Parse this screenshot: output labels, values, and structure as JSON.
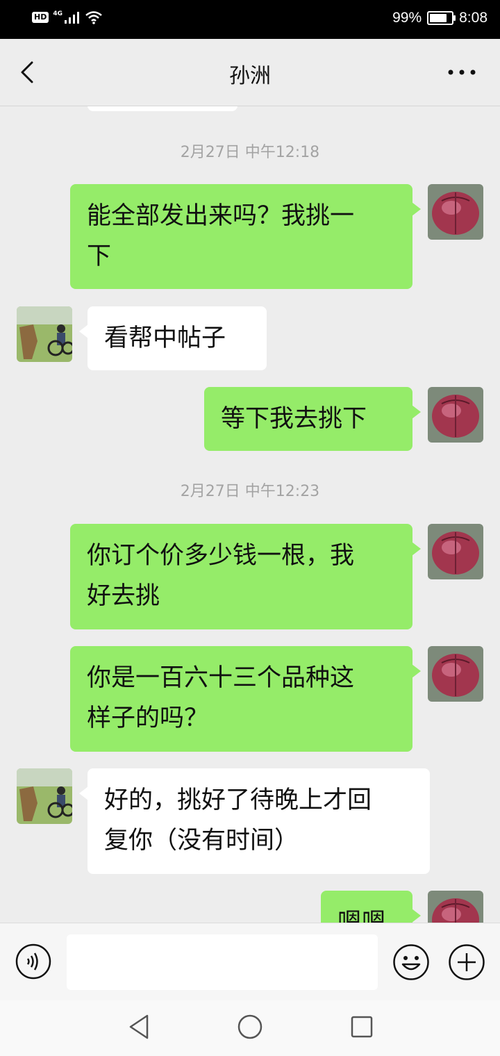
{
  "status_bar": {
    "hd": "HD",
    "network": "4G",
    "battery": "99%",
    "time": "8:08"
  },
  "header": {
    "title": "孙洲"
  },
  "chat": {
    "timestamps": [
      "2月27日 中午12:18",
      "2月27日 中午12:23"
    ],
    "messages": [
      {
        "side": "right",
        "line1": "能全部发出来吗？我挑一",
        "line2": "下"
      },
      {
        "side": "left",
        "line1": "看帮中帖子"
      },
      {
        "side": "right",
        "line1": "等下我去挑下"
      },
      {
        "side": "right",
        "line1": "你订个价多少钱一根，我",
        "line2": "好去挑"
      },
      {
        "side": "right",
        "line1": "你是一百六十三个品种这",
        "line2": "样子的吗？"
      },
      {
        "side": "left",
        "line1": "好的，挑好了待晚上才回",
        "line2": "复你（没有时间）"
      },
      {
        "side": "right",
        "line1": "嗯嗯"
      }
    ]
  },
  "input_bar": {
    "text_value": ""
  },
  "colors": {
    "bubble_sent": "#95ec69",
    "bubble_received": "#ffffff",
    "background": "#ededed"
  }
}
